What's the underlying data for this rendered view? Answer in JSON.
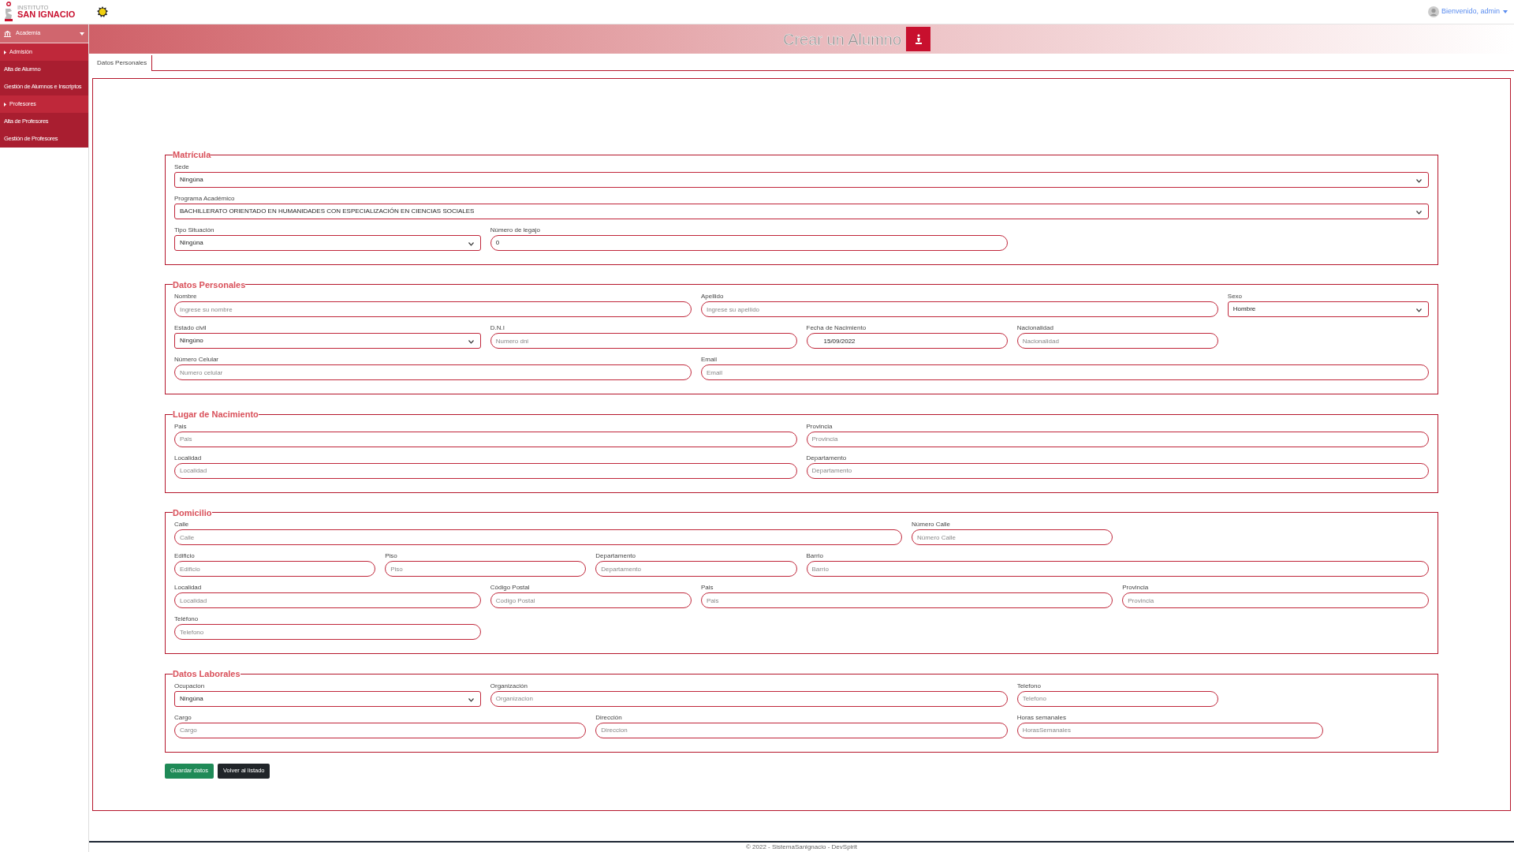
{
  "brand": {
    "small": "INSTITUTO",
    "name": "SAN IGNACIO"
  },
  "user": {
    "greeting": "Bienvenido, admin"
  },
  "sidebar": {
    "items": [
      {
        "label": "Academia",
        "children": [
          {
            "label": "Admisión",
            "children": [
              {
                "label": "Alta de Alumno"
              },
              {
                "label": "Gestión de Alumnos e Inscriptos"
              }
            ]
          },
          {
            "label": "Profesores",
            "children": [
              {
                "label": "Alta de Profesores"
              },
              {
                "label": "Gestión de Profesores"
              }
            ]
          }
        ]
      }
    ]
  },
  "banner": {
    "title": "Crear un Alumno"
  },
  "tabs": [
    {
      "label": "Datos Personales",
      "selected": true
    }
  ],
  "sections": [
    {
      "legend": "Matrícula",
      "rows": [
        [
          {
            "label": "Sede",
            "kind": "select",
            "value": "Ningúna"
          }
        ],
        [
          {
            "label": "Programa Académico",
            "kind": "select",
            "value": "BACHILLERATO ORIENTADO EN HUMANIDADES CON ESPECIALIZACIÓN EN CIENCIAS SOCIALES"
          }
        ],
        [
          {
            "label": "Tipo Situación",
            "kind": "select",
            "value": "Ningúna"
          },
          {
            "label": "Número de legajo",
            "kind": "input",
            "value": "0"
          }
        ]
      ]
    },
    {
      "legend": "Datos Personales",
      "rows": [
        [
          {
            "label": "Nombre",
            "kind": "input",
            "placeholder": "Ingrese su nombre"
          },
          {
            "label": "Apellido",
            "kind": "input",
            "placeholder": "Ingrese su apellido"
          },
          {
            "label": "Sexo",
            "kind": "select",
            "value": "Hombre"
          }
        ],
        [
          {
            "label": "Estado civil",
            "kind": "select",
            "value": "Ningúno"
          },
          {
            "label": "D.N.I",
            "kind": "input",
            "placeholder": "Numero dni"
          },
          {
            "label": "Fecha de Nacimiento",
            "kind": "date",
            "value": "15/09/2022"
          },
          {
            "label": "Nacionalidad",
            "kind": "input",
            "placeholder": "Nacionalidad"
          }
        ],
        [
          {
            "label": "Número Celular",
            "kind": "input",
            "placeholder": "Numero celular"
          },
          {
            "label": "Email",
            "kind": "input",
            "placeholder": "Email"
          }
        ]
      ]
    },
    {
      "legend": "Lugar de Nacimiento",
      "rows": [
        [
          {
            "label": "Pais",
            "kind": "input",
            "placeholder": "Pais"
          },
          {
            "label": "Provincia",
            "kind": "input",
            "placeholder": "Provincia"
          }
        ],
        [
          {
            "label": "Localidad",
            "kind": "input",
            "placeholder": "Localidad"
          },
          {
            "label": "Departamento",
            "kind": "input",
            "placeholder": "Departamento"
          }
        ]
      ]
    },
    {
      "legend": "Domicilio",
      "rows": [
        [
          {
            "label": "Calle",
            "kind": "input",
            "placeholder": "Calle"
          },
          {
            "label": "Número Calle",
            "kind": "input",
            "placeholder": "Número Calle"
          }
        ],
        [
          {
            "label": "Edificio",
            "kind": "input",
            "placeholder": "Edificio"
          },
          {
            "label": "Piso",
            "kind": "input",
            "placeholder": "Piso"
          },
          {
            "label": "Departamento",
            "kind": "input",
            "placeholder": "Departamento"
          },
          {
            "label": "Barrio",
            "kind": "input",
            "placeholder": "Barrio"
          }
        ],
        [
          {
            "label": "Localidad",
            "kind": "input",
            "placeholder": "Localidad"
          },
          {
            "label": "Código Postal",
            "kind": "input",
            "placeholder": "Codigo Postal"
          },
          {
            "label": "Pais",
            "kind": "input",
            "placeholder": "Pais"
          },
          {
            "label": "Provincia",
            "kind": "input",
            "placeholder": "Provincia"
          }
        ],
        [
          {
            "label": "Teléfono",
            "kind": "input",
            "placeholder": "Telefono"
          }
        ]
      ]
    },
    {
      "legend": "Datos Laborales",
      "rows": [
        [
          {
            "label": "Ocupacion",
            "kind": "select",
            "value": "Ningúna"
          },
          {
            "label": "Organización",
            "kind": "input",
            "placeholder": "Organizacion"
          },
          {
            "label": "Telefono",
            "kind": "input",
            "placeholder": "Telefono"
          }
        ],
        [
          {
            "label": "Cargo",
            "kind": "input",
            "placeholder": "Cargo"
          },
          {
            "label": "Dirección",
            "kind": "input",
            "placeholder": "Direccion"
          },
          {
            "label": "Horas semanales",
            "kind": "input",
            "placeholder": "HorasSemanales"
          }
        ]
      ]
    }
  ],
  "buttons": [
    {
      "label": "Guardar datos",
      "kind": "primary"
    },
    {
      "label": "Volver al listado",
      "kind": "dark"
    }
  ],
  "footer": "© 2022 - SistemaSanignacio - DevSpirit"
}
